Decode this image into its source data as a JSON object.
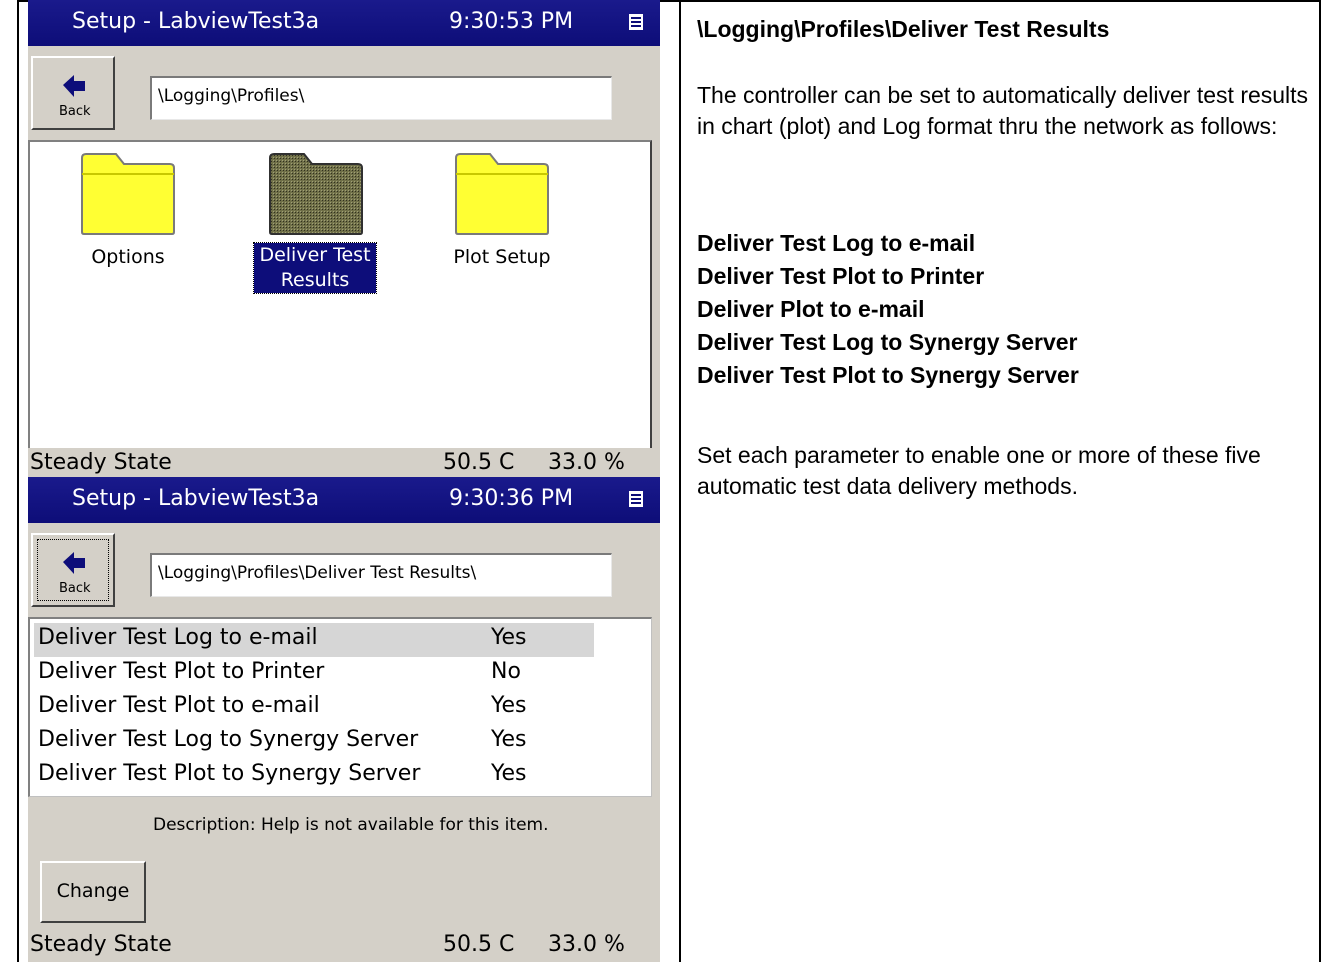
{
  "screen1": {
    "title": "Setup - LabviewTest3a",
    "clock": "9:30:53 PM",
    "back_label": "Back",
    "path": "\\Logging\\Profiles\\",
    "folders": [
      {
        "label": "Options",
        "icon": "folder-icon"
      },
      {
        "label_line1": "Deliver Test",
        "label_line2": "Results",
        "icon": "folder-icon",
        "selected": true
      },
      {
        "label": "Plot Setup",
        "icon": "folder-icon"
      }
    ],
    "status": {
      "state": "Steady State",
      "temp": "50.5 C",
      "humidity": "33.0 %"
    }
  },
  "screen2": {
    "title": "Setup - LabviewTest3a",
    "clock": "9:30:36 PM",
    "back_label": "Back",
    "path": "\\Logging\\Profiles\\Deliver Test Results\\",
    "items": [
      {
        "label": "Deliver Test Log to e-mail",
        "value": "Yes"
      },
      {
        "label": "Deliver Test Plot to Printer",
        "value": "No"
      },
      {
        "label": "Deliver Test Plot to e-mail",
        "value": "Yes"
      },
      {
        "label": "Deliver Test Log to Synergy Server",
        "value": "Yes"
      },
      {
        "label": "Deliver Test Plot to Synergy Server",
        "value": "Yes"
      }
    ],
    "description": "Description:  Help is not available for this item.",
    "change_label": "Change",
    "status": {
      "state": "Steady State",
      "temp": "50.5 C",
      "humidity": "33.0 %"
    }
  },
  "doc": {
    "heading": "\\Logging\\Profiles\\Deliver Test Results",
    "intro": "The controller can be set to automatically deliver test results in chart (plot) and Log format thru the network as follows:",
    "methods": [
      "Deliver Test Log to e-mail",
      "Deliver Test Plot to Printer",
      "Deliver Plot to e-mail",
      "Deliver Test Log to Synergy Server",
      "Deliver Test Plot to Synergy Server"
    ],
    "outro": "Set each parameter to enable one or more of these five automatic test data delivery methods."
  },
  "colors": {
    "titlebar": "#0d0d78",
    "selection": "#0d0d7a",
    "folder_yellow": "#ffff33",
    "window_gray": "#d4d0c8"
  }
}
